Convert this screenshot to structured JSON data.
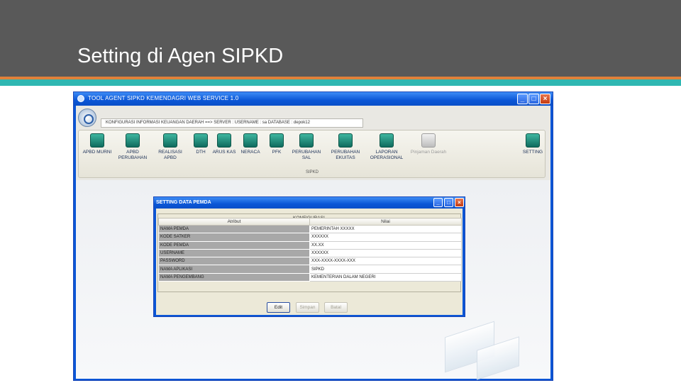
{
  "slide": {
    "title": "Setting di Agen SIPKD"
  },
  "window": {
    "title": "TOOL AGENT SIPKD KEMENDAGRI WEB SERVICE 1.0",
    "info_bar": "KONFIGURASI INFORMASI KEUANGAN DAERAH ==> SERVER : USERNAME : sa DATABASE : depok12",
    "ribbon_group": "SIPKD",
    "tools": [
      {
        "label": "APBD MURNI"
      },
      {
        "label": "APBD PERUBAHAN"
      },
      {
        "label": "REALISASI APBD"
      },
      {
        "label": "DTH"
      },
      {
        "label": "ARUS KAS"
      },
      {
        "label": "NERACA"
      },
      {
        "label": "PFK"
      },
      {
        "label": "PERUBAHAN SAL"
      },
      {
        "label": "PERUBAHAN EKUITAS"
      },
      {
        "label": "LAPORAN OPERASIONAL"
      },
      {
        "label": "Pinjaman Daerah"
      },
      {
        "label": "SETTING"
      }
    ]
  },
  "dialog": {
    "title": "SETTING DATA PEMDA",
    "legend": "KONFIGURASI",
    "columns": [
      "Atribut",
      "Nilai"
    ],
    "rows": [
      {
        "attr": "NAMA PEMDA",
        "value": "PEMERINTAH XXXXX"
      },
      {
        "attr": "KODE SATKER",
        "value": "XXXXXX"
      },
      {
        "attr": "KODE PEMDA",
        "value": "XX.XX"
      },
      {
        "attr": "USERNAME",
        "value": "XXXXXX"
      },
      {
        "attr": "PASSWORD",
        "value": "XXX-XXXX-XXXX-XXX"
      },
      {
        "attr": "NAMA APLIKASI",
        "value": "SIPKD"
      },
      {
        "attr": "NAMA PENGEMBANG",
        "value": "KEMENTERIAN DALAM NEGERI"
      }
    ],
    "buttons": {
      "edit": "Edit",
      "simpan": "Simpan",
      "batal": "Batal"
    }
  },
  "colors": {
    "header": "#595959",
    "accent_orange": "#e0813a",
    "accent_teal": "#2fb7b2",
    "titlebar": "#0b56d6"
  }
}
